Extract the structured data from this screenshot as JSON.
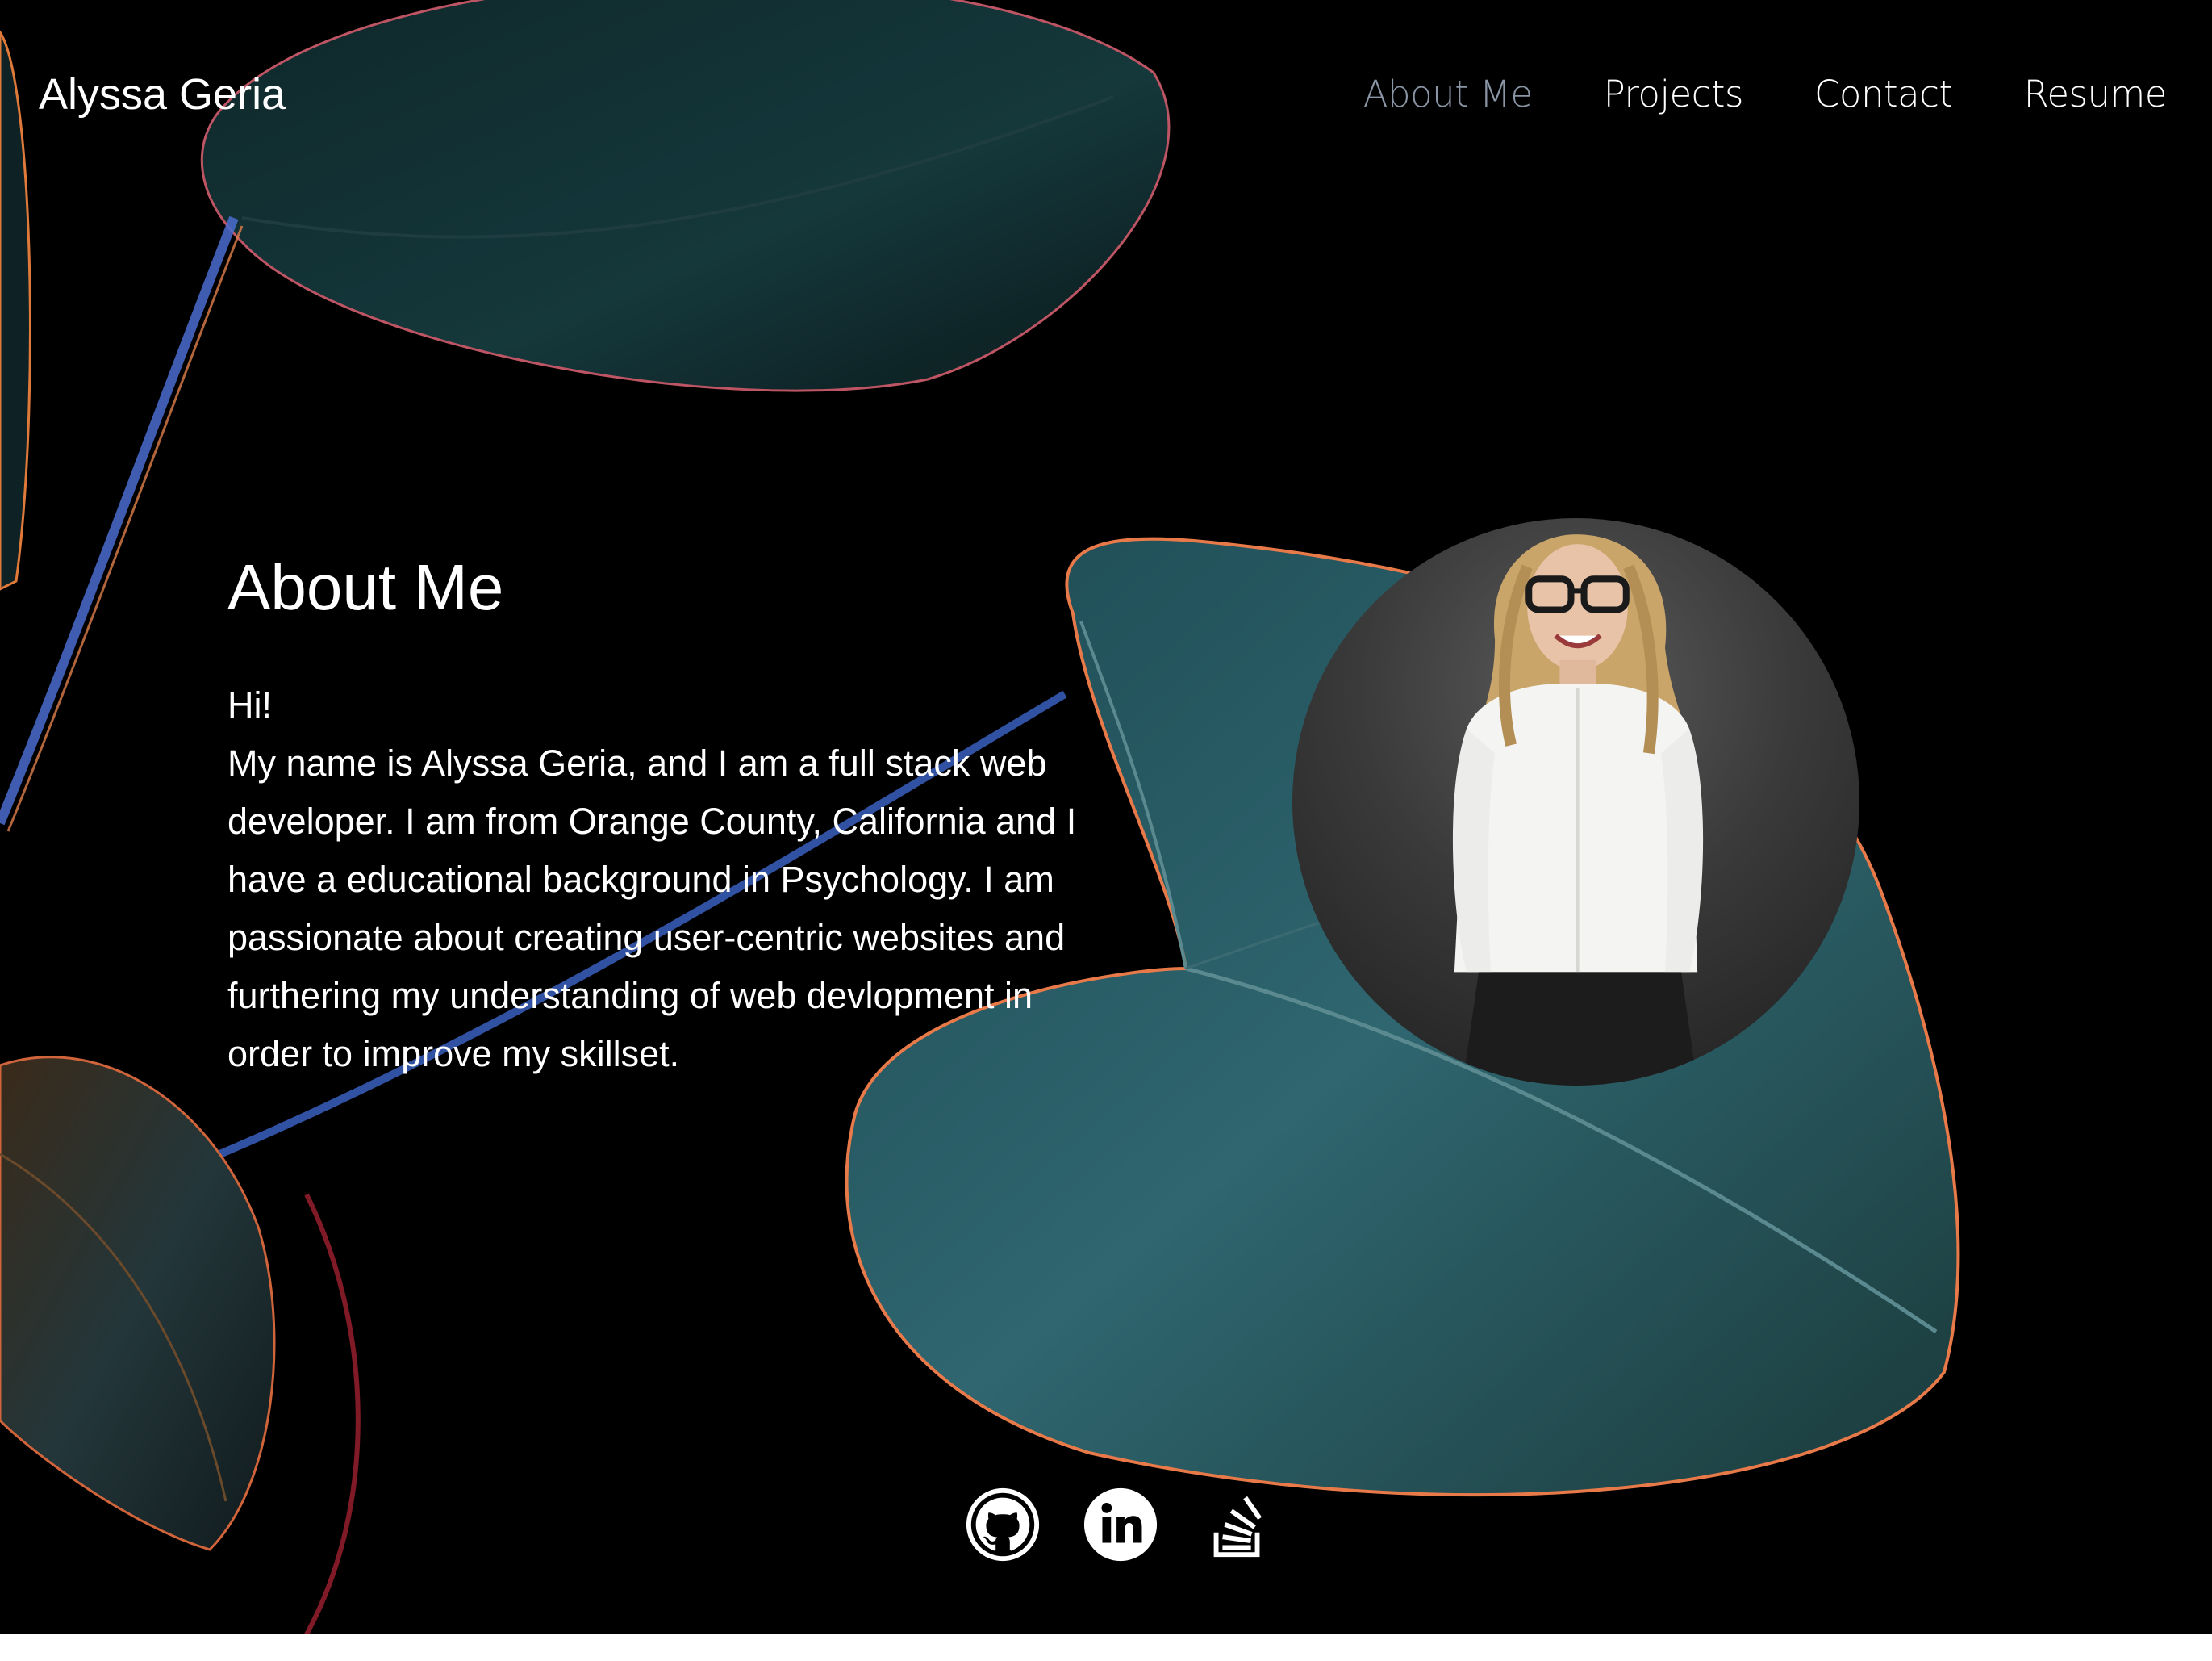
{
  "site": {
    "brand": "Alyssa Geria"
  },
  "nav": {
    "items": [
      {
        "label": "About Me",
        "active": true
      },
      {
        "label": "Projects",
        "active": false
      },
      {
        "label": "Contact",
        "active": false
      },
      {
        "label": "Resume",
        "active": false
      }
    ]
  },
  "about": {
    "title": "About Me",
    "greeting": "Hi!",
    "body": "My name is Alyssa Geria, and I am a full stack web developer. I am from Orange County, California and I have a educational background in Psychology. I am passionate about creating user-centric websites and furthering my understanding of web devlopment in order to improve my skillset."
  },
  "socials": [
    {
      "icon": "github-icon"
    },
    {
      "icon": "linkedin-icon"
    },
    {
      "icon": "stackoverflow-icon"
    }
  ],
  "colors": {
    "background": "#000000",
    "text": "#ffffff",
    "nav_active": "#8a96a6",
    "leaf_teal": "#2c5b63",
    "leaf_rim": "#e0704a",
    "footer_strip": "#ffffff"
  }
}
